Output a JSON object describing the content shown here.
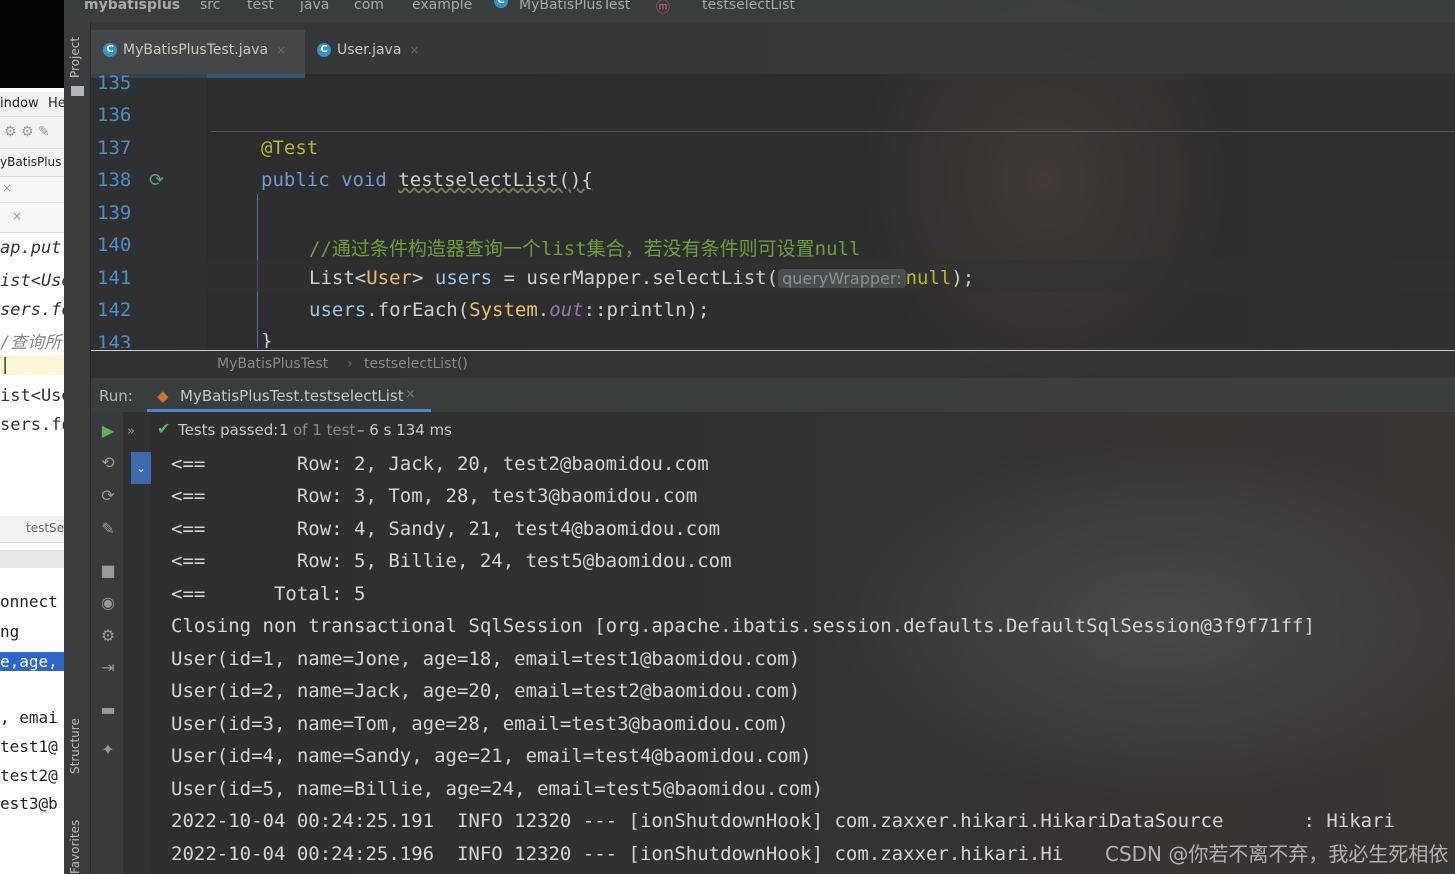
{
  "navbar": {
    "items": [
      "mybatisplus",
      "src",
      "test",
      "java",
      "com",
      "example",
      "MyBatisPlusTest",
      "testselectList"
    ]
  },
  "left_window": {
    "menu_window": "indow",
    "menu_help": "He",
    "project": "yBatisPlus",
    "code_lines": [
      "ap.put(",
      "ist<Use",
      "sers.fo",
      "/查询所",
      "|",
      "ist<Use",
      "sers.fo"
    ],
    "crumb": "testSe",
    "console_lines": [
      "onnect",
      "ng",
      "e,age,",
      ", emai",
      "test1@",
      "test2@",
      "est3@b"
    ]
  },
  "sidebar": {
    "project_label": "Project",
    "structure_label": "Structure",
    "favorites_label": "Favorites"
  },
  "tabs": [
    {
      "label": "MyBatisPlusTest.java",
      "icon": "C"
    },
    {
      "label": "User.java",
      "icon": "C"
    }
  ],
  "editor": {
    "line_numbers": [
      "135",
      "136",
      "137",
      "138",
      "139",
      "140",
      "141",
      "142",
      "143"
    ],
    "annotation": "@Test",
    "kw_public": "public",
    "kw_void": "void",
    "method_sig": "testselectList(){",
    "comment": "//通过条件构造器查询一个list集合，若没有条件则可设置null",
    "list_type": "List",
    "lt": "<",
    "user_type": "User",
    "gt_space": "> ",
    "users_var": "users",
    "assign": " = userMapper.selectList(",
    "param_hint": "queryWrapper:",
    "null_kw": "null",
    "close_call": ");",
    "foreach_var": "users",
    "foreach_call": ".forEach(",
    "system_type": "System",
    "dot": ".",
    "out_field": "out",
    "println_part": "::println);",
    "closing_brace": "}"
  },
  "breadcrumb": {
    "class_name": "MyBatisPlusTest",
    "method_name": "testselectList()"
  },
  "run": {
    "label": "Run:",
    "config": "MyBatisPlusTest.testselectList"
  },
  "status": {
    "prefix": "Tests passed:",
    "passed": "1",
    "of_text": "of 1 test",
    "duration": "– 6 s 134 ms"
  },
  "console": {
    "lines": [
      "<==        Row: 2, Jack, 20, test2@baomidou.com",
      "<==        Row: 3, Tom, 28, test3@baomidou.com",
      "<==        Row: 4, Sandy, 21, test4@baomidou.com",
      "<==        Row: 5, Billie, 24, test5@baomidou.com",
      "<==      Total: 5",
      "Closing non transactional SqlSession [org.apache.ibatis.session.defaults.DefaultSqlSession@3f9f71ff]",
      "User(id=1, name=Jone, age=18, email=test1@baomidou.com)",
      "User(id=2, name=Jack, age=20, email=test2@baomidou.com)",
      "User(id=3, name=Tom, age=28, email=test3@baomidou.com)",
      "User(id=4, name=Sandy, age=21, email=test4@baomidou.com)",
      "User(id=5, name=Billie, age=24, email=test5@baomidou.com)",
      "2022-10-04 00:24:25.191  INFO 12320 --- [ionShutdownHook] com.zaxxer.hikari.HikariDataSource       : Hikari",
      "2022-10-04 00:24:25.196  INFO 12320 --- [ionShutdownHook] com.zaxxer.hikari.Hi"
    ]
  },
  "watermark": "CSDN @你若不离不弃，我必生死相依"
}
